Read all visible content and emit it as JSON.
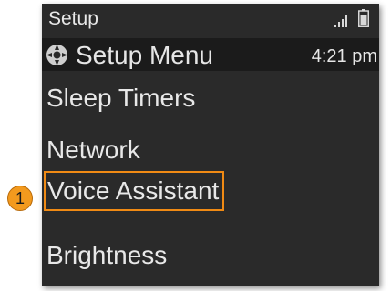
{
  "status_bar": {
    "title": "Setup",
    "icons": [
      "signal-icon",
      "battery-icon"
    ]
  },
  "header": {
    "icon": "settings-wheel-icon",
    "title": "Setup Menu",
    "time": "4:21 pm"
  },
  "menu": {
    "items": [
      {
        "label": "Sleep Timers",
        "selected": false
      },
      {
        "label": "Network",
        "selected": false
      },
      {
        "label": "Voice Assistant",
        "selected": true
      },
      {
        "label": "Brightness",
        "selected": false
      }
    ]
  },
  "callout": {
    "label": "1"
  },
  "colors": {
    "screen_bg": "#2a2a2a",
    "header_bg": "#1b1b1b",
    "highlight": "#f08a14",
    "callout": "#f39a1e",
    "text": "#e8e8e8"
  }
}
